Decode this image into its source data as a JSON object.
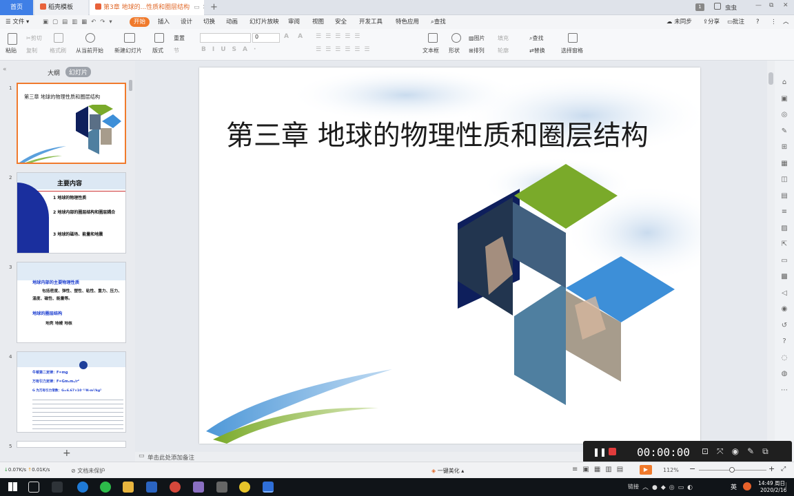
{
  "tabs": {
    "home": "首页",
    "template": "稻壳模板",
    "doc": "第3章 地球的...性质和圈层结构"
  },
  "topright": {
    "user": "虫虫"
  },
  "menu": {
    "file": "文件",
    "items": [
      "开始",
      "插入",
      "设计",
      "切换",
      "动画",
      "幻灯片放映",
      "审阅",
      "视图",
      "安全",
      "开发工具",
      "特色应用"
    ],
    "search": "查找",
    "sync": "未同步",
    "share": "分享",
    "comment": "批注"
  },
  "ribbon": {
    "paste": "粘贴",
    "cut": "剪切",
    "copy": "复制",
    "format_painter": "格式刷",
    "play_from": "从当前开始",
    "new_slide": "新建幻灯片",
    "layout": "版式",
    "section": "节",
    "reset": "重置",
    "font_size": "0",
    "textbox": "文本框",
    "shape": "形状",
    "picture": "图片",
    "arrange": "排列",
    "fill": "填充",
    "outline": "轮廓",
    "find": "查找",
    "replace": "替换",
    "select_pane": "选择窗格"
  },
  "panel": {
    "outline_tab": "大纲",
    "slides_tab": "幻灯片",
    "add": "+"
  },
  "thumbs": [
    {
      "num": "1",
      "title": "第三章 地球的物理性质和圈层结构"
    },
    {
      "num": "2",
      "title": "主要内容",
      "items": [
        "1 地球的物理性质",
        "2 地球内部的圈层结构和圈层耦合",
        "3 地球的磁场、能量和地震"
      ]
    },
    {
      "num": "3",
      "h1": "地球内部的主要物理性质",
      "p1": "包括密度、弹性、塑性、粘性、重力、压力、温度、磁性、能量等。",
      "h2": "地球的圈层结构",
      "p2": "地壳 地幔 地核"
    },
    {
      "num": "4",
      "l1": "牛顿第二定律：F=mg",
      "l2": "万有引力定律：F=Gm₁m₂/r²",
      "l3": "G 为万有引力常数：G=6.67×10⁻¹¹N·m²/kg²"
    },
    {
      "num": "5"
    }
  ],
  "slide": {
    "title": "第三章 地球的物理性质和圈层结构"
  },
  "notes": {
    "placeholder": "单击此处添加备注"
  },
  "recorder": {
    "time": "00:00:00"
  },
  "status": {
    "down": "0.07K/s",
    "up": "0.01K/s",
    "protect": "文档未保护",
    "beautify": "一键美化",
    "zoom": "112%"
  },
  "taskbar": {
    "link": "链接",
    "ime": "英",
    "time": "14:49 周日",
    "date": "2020/2/16"
  },
  "colors": {
    "accent": "#f07a2c",
    "wps_blue": "#3f7fe6",
    "green": "#7aaa2a",
    "lightblue": "#3d8fd8",
    "steel": "#4f7fa0",
    "navy": "#0e1f5c"
  }
}
